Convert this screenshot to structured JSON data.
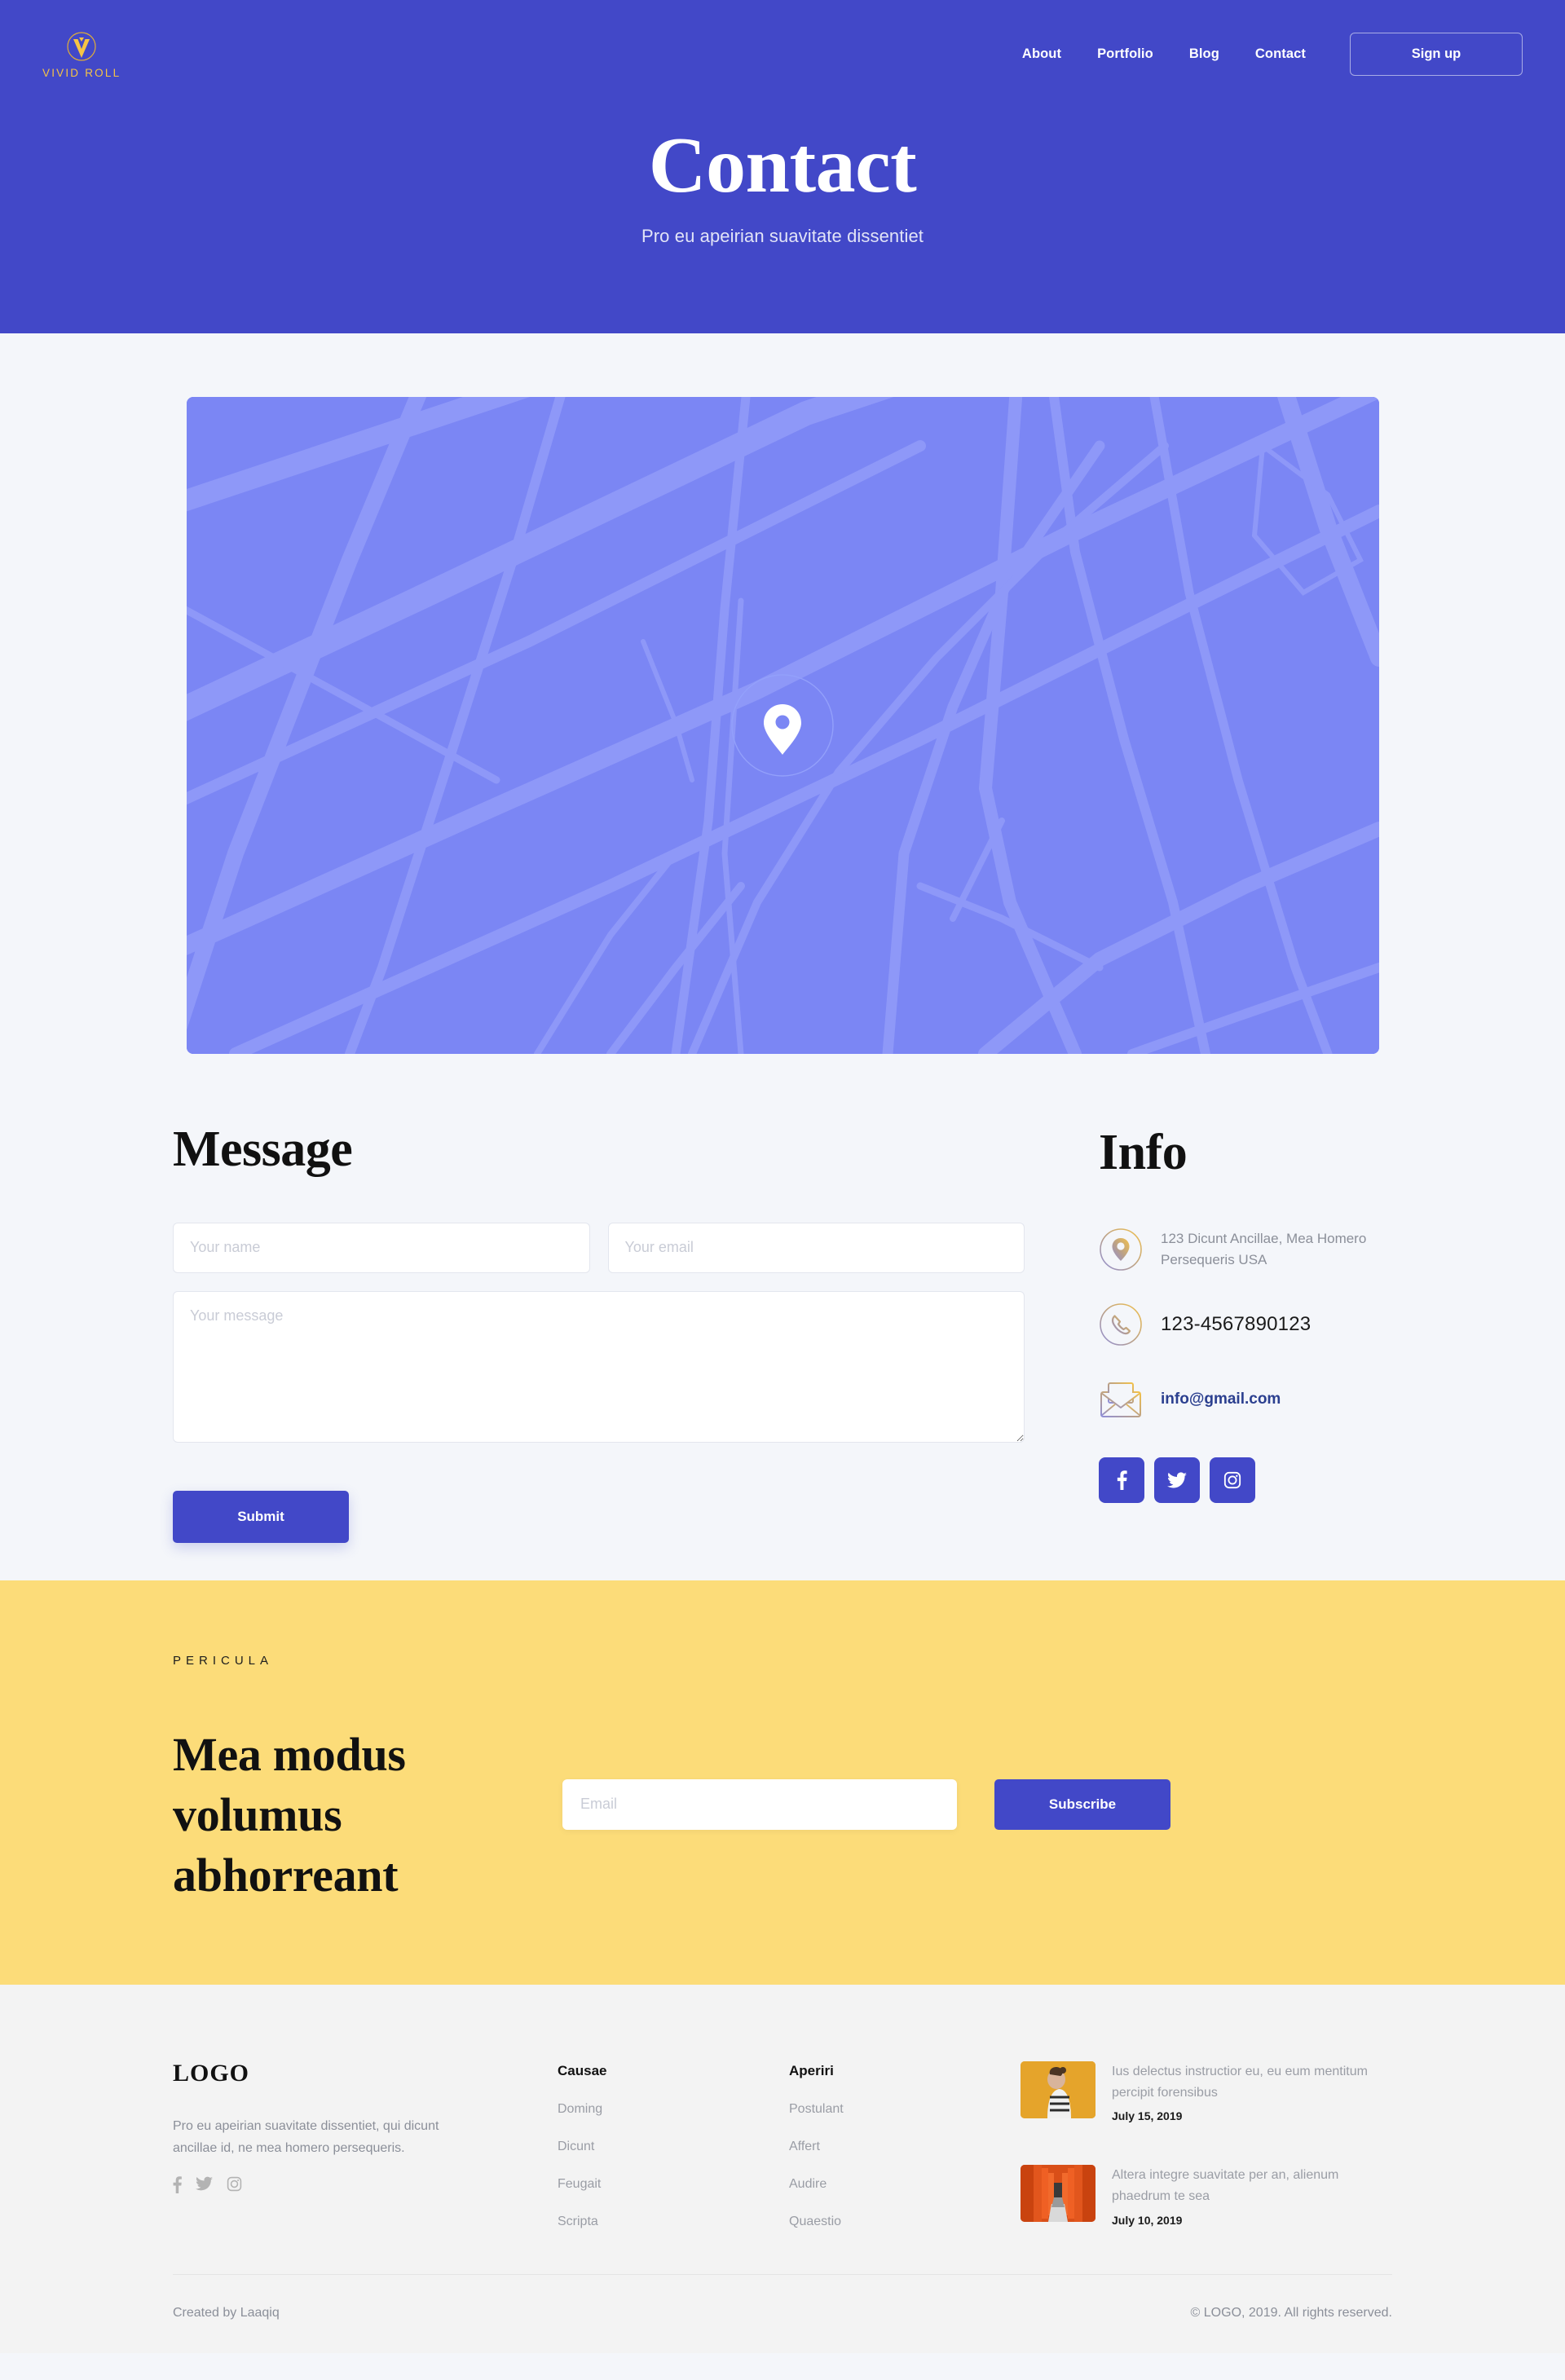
{
  "brand": {
    "name": "VIVID ROLL",
    "mark_color": "#f6c445"
  },
  "nav": {
    "links": [
      {
        "label": "About"
      },
      {
        "label": "Portfolio"
      },
      {
        "label": "Blog"
      },
      {
        "label": "Contact"
      }
    ],
    "signup_label": "Sign up"
  },
  "hero": {
    "title": "Contact",
    "subtitle": "Pro eu apeirian suavitate dissentiet",
    "bg_color": "#4248c8"
  },
  "map": {
    "bg_color": "#7b86f4",
    "road_color": "#8e98f8",
    "marker": "location-pin"
  },
  "message": {
    "title": "Message",
    "name_placeholder": "Your name",
    "name_value": "",
    "email_placeholder": "Your email",
    "email_value": "",
    "message_placeholder": "Your message",
    "message_value": "",
    "submit_label": "Submit"
  },
  "info": {
    "title": "Info",
    "address": "123 Dicunt Ancillae, Mea Homero Persequeris USA",
    "phone": "123-4567890123",
    "email": "info@gmail.com",
    "socials": [
      {
        "name": "facebook"
      },
      {
        "name": "twitter"
      },
      {
        "name": "instagram"
      }
    ]
  },
  "newsletter": {
    "kicker": "PERICULA",
    "title": "Mea modus volumus abhorreant",
    "email_placeholder": "Email",
    "email_value": "",
    "subscribe_label": "Subscribe",
    "bg_color": "#fcdc79"
  },
  "footer": {
    "logo": "LOGO",
    "description": "Pro eu apeirian suavitate dissentiet, qui dicunt ancillae id, ne mea homero persequeris.",
    "socials": [
      {
        "name": "facebook"
      },
      {
        "name": "twitter"
      },
      {
        "name": "instagram"
      }
    ],
    "columns": [
      {
        "title": "Causae",
        "links": [
          {
            "label": "Doming"
          },
          {
            "label": "Dicunt"
          },
          {
            "label": "Feugait"
          },
          {
            "label": "Scripta"
          }
        ]
      },
      {
        "title": "Aperiri",
        "links": [
          {
            "label": "Postulant"
          },
          {
            "label": "Affert"
          },
          {
            "label": "Audire"
          },
          {
            "label": "Quaestio"
          }
        ]
      }
    ],
    "posts": [
      {
        "title": "Ius delectus instructior eu, eu eum mentitum percipit forensibus",
        "date": "July 15, 2019",
        "thumb": "woman-yellow-wall"
      },
      {
        "title": "Altera integre suavitate per an, alienum phaedrum te sea",
        "date": "July 10, 2019",
        "thumb": "orange-torii-gates"
      }
    ],
    "created_by": "Created by Laaqiq",
    "copyright": "© LOGO, 2019. All rights reserved."
  }
}
